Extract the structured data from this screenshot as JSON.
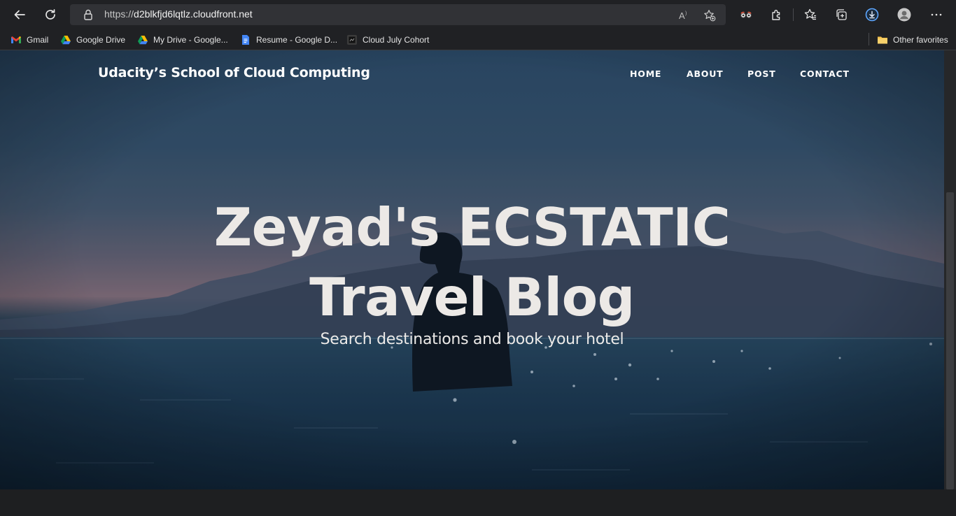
{
  "browser": {
    "url_scheme": "https://",
    "url_host": "d2blkfjd6lqtlz.cloudfront.net",
    "icons": {
      "back": "back-arrow-icon",
      "refresh": "refresh-icon",
      "lock": "lock-icon",
      "read_aloud": "read-aloud-icon",
      "add_favorite": "add-favorite-icon",
      "extension_glasses": "extension-icon",
      "extensions": "puzzle-icon",
      "favorites": "favorites-icon",
      "collections": "collections-icon",
      "downloads": "download-icon",
      "profile": "profile-icon",
      "menu": "more-icon"
    },
    "bookmarks": [
      {
        "label": "Gmail",
        "icon": "gmail-icon"
      },
      {
        "label": "Google Drive",
        "icon": "google-drive-icon"
      },
      {
        "label": "My Drive - Google...",
        "icon": "google-drive-icon"
      },
      {
        "label": "Resume - Google D...",
        "icon": "google-docs-icon"
      },
      {
        "label": "Cloud July Cohort",
        "icon": "cohort-icon"
      }
    ],
    "other_favorites": "Other favorites"
  },
  "site": {
    "brand": "Udacity’s School of Cloud Computing",
    "nav": [
      "HOME",
      "ABOUT",
      "POST",
      "CONTACT"
    ],
    "hero_title_line1": "Zeyad's ECSTATIC",
    "hero_title_line2": "Travel Blog",
    "hero_subtitle": "Search destinations and book your hotel"
  },
  "colors": {
    "accent_download": "#5ea7ff",
    "hero_text": "#ece9e6",
    "chrome_bg": "#202124"
  }
}
